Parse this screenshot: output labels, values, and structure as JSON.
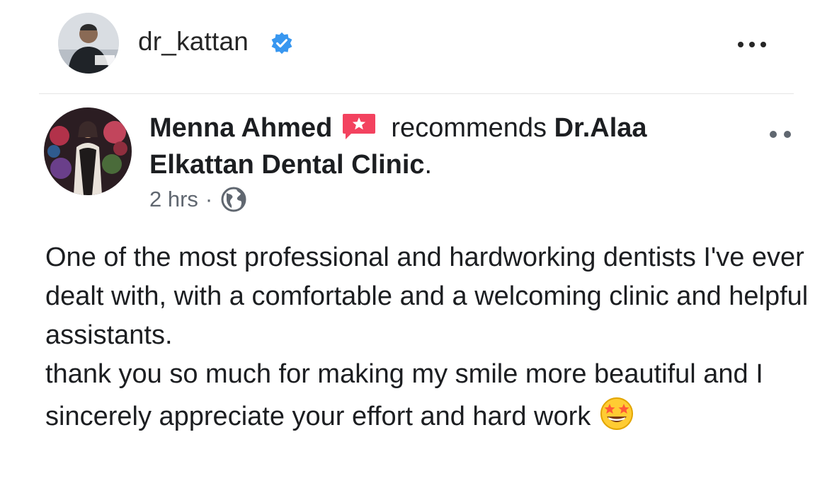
{
  "post": {
    "owner_name": "dr_kattan",
    "verified_icon": "verified-badge-icon",
    "more_icon": "more-options-icon"
  },
  "review": {
    "reviewer_name": "Menna Ahmed",
    "recommend_icon": "recommend-star-icon",
    "recommends_text": "recommends",
    "page_name": "Dr.Alaa Elkattan Dental Clinic",
    "page_suffix": ".",
    "time": "2 hrs",
    "separator": "·",
    "privacy_icon": "globe-icon",
    "more_icon": "more-options-icon",
    "body_lines": [
      "One of the most professional and hardworking dentists I've ever dealt with, with a comfortable and a welcoming clinic and helpful assistants.",
      "thank you so much for making my smile more beautiful and I sincerely appreciate your effort and hard work"
    ],
    "emoji": "star-struck-emoji"
  },
  "colors": {
    "verified_blue": "#3897f0",
    "recommend_red": "#f3425f",
    "text_primary": "#1c1e21",
    "text_secondary": "#606770"
  }
}
